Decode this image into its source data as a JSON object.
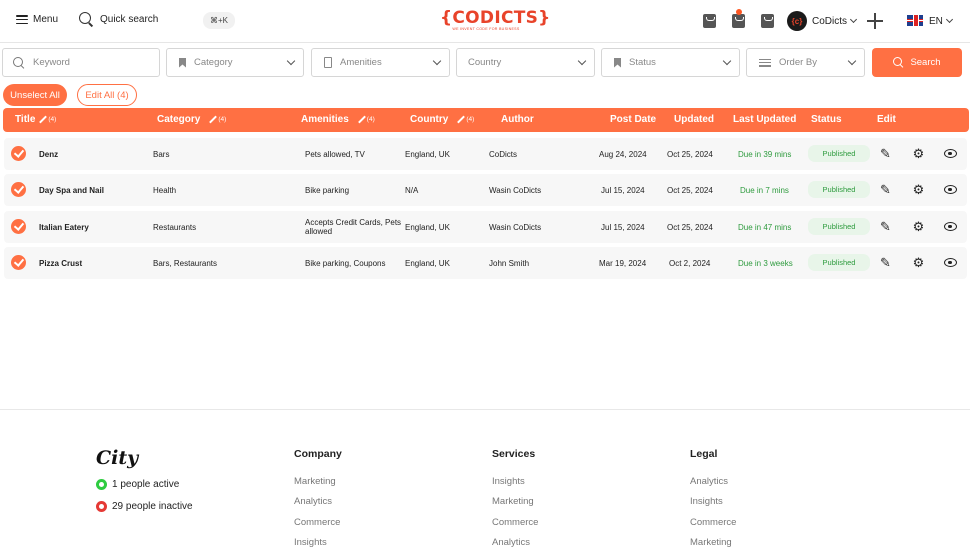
{
  "topbar": {
    "menu_label": "Menu",
    "quick_search_label": "Quick search",
    "shortcut": "⌘+K",
    "logo_text": "{CODICTS}",
    "logo_tagline": "WE INVENT CODE FOR BUSINESS",
    "user_initials": "{c}",
    "user_name": "CoDicts",
    "language": "EN"
  },
  "filters": {
    "keyword_placeholder": "Keyword",
    "category_label": "Category",
    "amenities_label": "Amenities",
    "country_label": "Country",
    "status_label": "Status",
    "order_by_label": "Order By",
    "search_button": "Search"
  },
  "actions": {
    "unselect_all": "Unselect All",
    "edit_all": "Edit All (4)"
  },
  "table": {
    "headers": {
      "title": "Title",
      "title_count": "(4)",
      "category": "Category",
      "category_count": "(4)",
      "amenities": "Amenities",
      "amenities_count": "(4)",
      "country": "Country",
      "country_count": "(4)",
      "author": "Author",
      "post_date": "Post Date",
      "updated": "Updated",
      "last_updated": "Last Updated",
      "status": "Status",
      "edit": "Edit"
    },
    "rows": [
      {
        "title": "Denz",
        "category": "Bars",
        "amenities": "Pets allowed, TV",
        "country": "England, UK",
        "author": "CoDicts",
        "post_date": "Aug 24, 2024",
        "updated": "Oct 25, 2024",
        "last_updated": "Due in 39 mins",
        "status": "Published"
      },
      {
        "title": "Day Spa and Nail",
        "category": "Health",
        "amenities": "Bike parking",
        "country": "N/A",
        "author": "Wasin CoDicts",
        "post_date": "Jul 15, 2024",
        "updated": "Oct 25, 2024",
        "last_updated": "Due in 7 mins",
        "status": "Published"
      },
      {
        "title": "Italian Eatery",
        "category": "Restaurants",
        "amenities": "Accepts Credit Cards, Pets allowed",
        "country": "England, UK",
        "author": "Wasin CoDicts",
        "post_date": "Jul 15, 2024",
        "updated": "Oct 25, 2024",
        "last_updated": "Due in 47 mins",
        "status": "Published"
      },
      {
        "title": "Pizza Crust",
        "category": "Bars, Restaurants",
        "amenities": "Bike parking, Coupons",
        "country": "England, UK",
        "author": "John Smith",
        "post_date": "Mar 19, 2024",
        "updated": "Oct 2, 2024",
        "last_updated": "Due in 3 weeks",
        "status": "Published"
      }
    ]
  },
  "footer": {
    "brand": "City",
    "active": "1 people active",
    "inactive": "29 people inactive",
    "columns": [
      {
        "heading": "Company",
        "links": [
          "Marketing",
          "Analytics",
          "Commerce",
          "Insights"
        ]
      },
      {
        "heading": "Services",
        "links": [
          "Insights",
          "Marketing",
          "Commerce",
          "Analytics"
        ]
      },
      {
        "heading": "Legal",
        "links": [
          "Analytics",
          "Insights",
          "Commerce",
          "Marketing"
        ]
      }
    ]
  },
  "colors": {
    "accent": "#ff7043",
    "brand_red": "#e8432a",
    "success": "#2e9b3e"
  },
  "icons": [
    "hamburger-icon",
    "search-icon",
    "inbox-icon",
    "notification-icon",
    "download-icon",
    "plus-icon",
    "uk-flag-icon",
    "bookmark-icon",
    "pencil-icon",
    "gear-icon",
    "eye-icon",
    "check-icon"
  ]
}
